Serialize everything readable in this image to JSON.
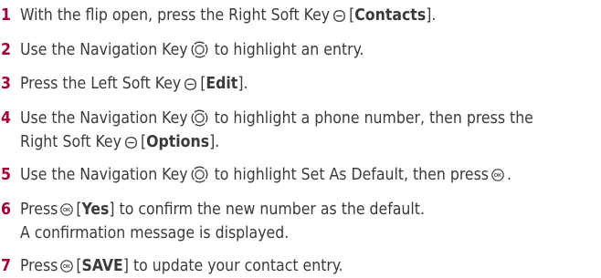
{
  "steps": [
    {
      "num": "1",
      "parts": [
        "With the flip open, press the Right Soft Key",
        "[",
        "Contacts",
        "]."
      ]
    },
    {
      "num": "2",
      "parts": [
        "Use the Navigation Key",
        "to highlight an entry."
      ]
    },
    {
      "num": "3",
      "parts": [
        "Press the Left Soft Key",
        "[",
        "Edit",
        "]."
      ]
    },
    {
      "num": "4",
      "parts": [
        "Use the Navigation Key",
        "to highlight a phone number, then press the",
        "Right Soft Key",
        "[",
        "Options",
        "]."
      ]
    },
    {
      "num": "5",
      "parts": [
        "Use the Navigation Key",
        "to highlight Set As Default, then press",
        "."
      ]
    },
    {
      "num": "6",
      "parts": [
        "Press",
        "[",
        "Yes",
        "] to confirm the new number as the default.",
        "A confirmation message is displayed."
      ]
    },
    {
      "num": "7",
      "parts": [
        "Press",
        "[",
        "SAVE",
        "] to update your contact entry."
      ]
    }
  ],
  "icons": {
    "soft_key": "soft-key-icon",
    "navigation_key": "navigation-key-icon",
    "ok_key": "ok-key-icon"
  },
  "colors": {
    "step_number": "#a50034",
    "text": "#3a3a3a"
  }
}
